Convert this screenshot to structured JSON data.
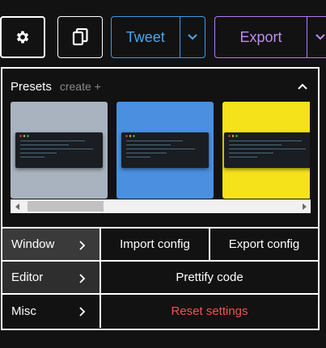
{
  "toolbar": {
    "settings_icon": "gear-icon",
    "copy_icon": "copy-icon",
    "tweet_label": "Tweet",
    "export_label": "Export",
    "colors": {
      "tweet": "#49a6f0",
      "export": "#c18bf5"
    }
  },
  "presets": {
    "title": "Presets",
    "create_label": "create +",
    "items": [
      {
        "background": "#a8b3bf"
      },
      {
        "background": "#4a8fe0"
      },
      {
        "background": "#f5e21a"
      }
    ]
  },
  "menu": {
    "tabs": [
      {
        "label": "Window"
      },
      {
        "label": "Editor"
      },
      {
        "label": "Misc"
      }
    ],
    "import_label": "Import config",
    "export_label": "Export config",
    "prettify_label": "Prettify code",
    "reset_label": "Reset settings",
    "reset_color": "#f05252"
  }
}
